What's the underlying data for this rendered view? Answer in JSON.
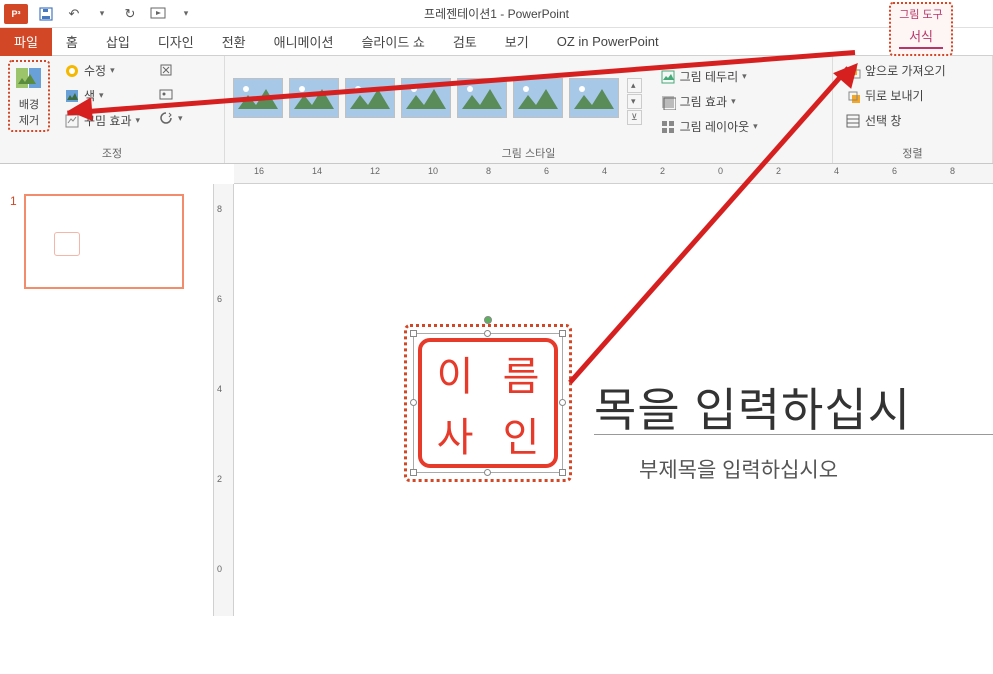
{
  "titlebar": {
    "app_icon_text": "P³",
    "title": "프레젠테이션1 - PowerPoint",
    "tool_tab_group": "그림 도구",
    "tool_tab": "서식"
  },
  "qat": {
    "save": "save-icon",
    "undo": "↶",
    "redo": "↻",
    "start": "▷",
    "touch": "touch-icon"
  },
  "tabs": {
    "file": "파일",
    "home": "홈",
    "insert": "삽입",
    "design": "디자인",
    "transitions": "전환",
    "animations": "애니메이션",
    "slideshow": "슬라이드 쇼",
    "review": "검토",
    "view": "보기",
    "oz": "OZ in PowerPoint"
  },
  "ribbon": {
    "remove_bg": "배경\n제거",
    "adjust_group": "조정",
    "corrections": "수정",
    "color": "색",
    "artistic": "꾸밈 효과",
    "styles_group": "그림 스타일",
    "border": "그림 테두리",
    "effects": "그림 효과",
    "layout": "그림 레이아웃",
    "bring_forward": "앞으로 가져오기",
    "send_backward": "뒤로 보내기",
    "selection_pane": "선택 창",
    "arrange_group": "정렬"
  },
  "slide": {
    "number": "1",
    "title_placeholder": "목을 입력하십시",
    "subtitle_placeholder": "부제목을 입력하십시오",
    "stamp_tl": "이",
    "stamp_tr": "름",
    "stamp_bl": "사",
    "stamp_br": "인"
  },
  "ruler": {
    "h": [
      "16",
      "14",
      "12",
      "10",
      "8",
      "6",
      "4",
      "2",
      "0",
      "2",
      "4",
      "6",
      "8"
    ],
    "v": [
      "8",
      "6",
      "4",
      "2",
      "0"
    ]
  }
}
